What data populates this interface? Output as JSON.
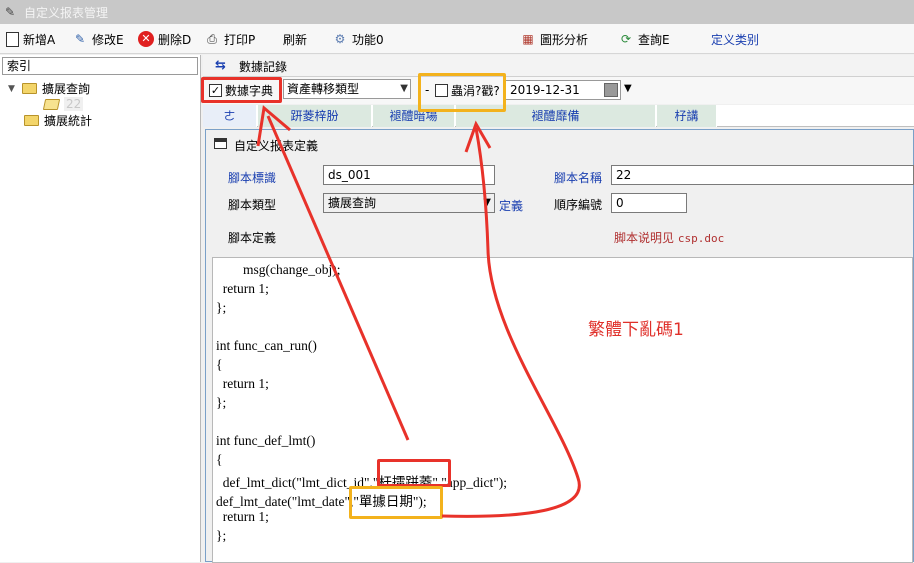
{
  "window": {
    "title": "自定义报表管理"
  },
  "toolbar": {
    "new_label": "新增A",
    "edit_label": "修改E",
    "delete_label": "删除D",
    "print_label": "打印P",
    "refresh_label": "刷新",
    "function_label": "功能0",
    "chart_label": "圖形分析",
    "query_label": "查詢E",
    "category_label": "定义类别"
  },
  "left": {
    "header": "索引",
    "tree": [
      {
        "label": "擴展查詢"
      },
      {
        "label": "22"
      },
      {
        "label": "擴展統計"
      }
    ]
  },
  "right": {
    "header_label": "數據記錄",
    "filter": {
      "dict_checkbox_label": "數據字典",
      "dict_checked": true,
      "type_select": "資產轉移類型",
      "dash": "-",
      "garbled_checkbox_label": "蟲涓?戳?",
      "date_value": "2019-12-31"
    },
    "tabs": [
      "ㄜ",
      "趼菱梓朌",
      "褪醴暗場",
      "褪醴靡備",
      "杍講"
    ]
  },
  "dialog": {
    "title": "自定义报表定義",
    "fields": {
      "script_id_label": "腳本標識",
      "script_id_value": "ds_001",
      "script_name_label": "腳本名稱",
      "script_name_value": "22",
      "script_type_label": "腳本類型",
      "script_type_value": "擴展查詢",
      "define_link": "定義",
      "order_label": "順序編號",
      "order_value": "0",
      "script_def_label": "腳本定義",
      "note_prefix": "脚本说明见",
      "note_file": "csp.doc"
    },
    "code_lines": [
      "        msg(change_obj);",
      "  return 1;",
      "};",
      "",
      "int func_can_run()",
      "{",
      "  return 1;",
      "};",
      "",
      "int func_def_lmt()",
      "{",
      "  def_lmt_dict(\"lmt_dict_id\",\"杆擂跰菱\",\"app_dict\");",
      "def_lmt_date(\"lmt_date\",\"單據日期\");",
      "  return 1;",
      "};"
    ]
  },
  "annotation": {
    "text": "繁體下亂碼1",
    "colors": {
      "red": "#e8322a",
      "orange": "#f3b21c"
    }
  }
}
